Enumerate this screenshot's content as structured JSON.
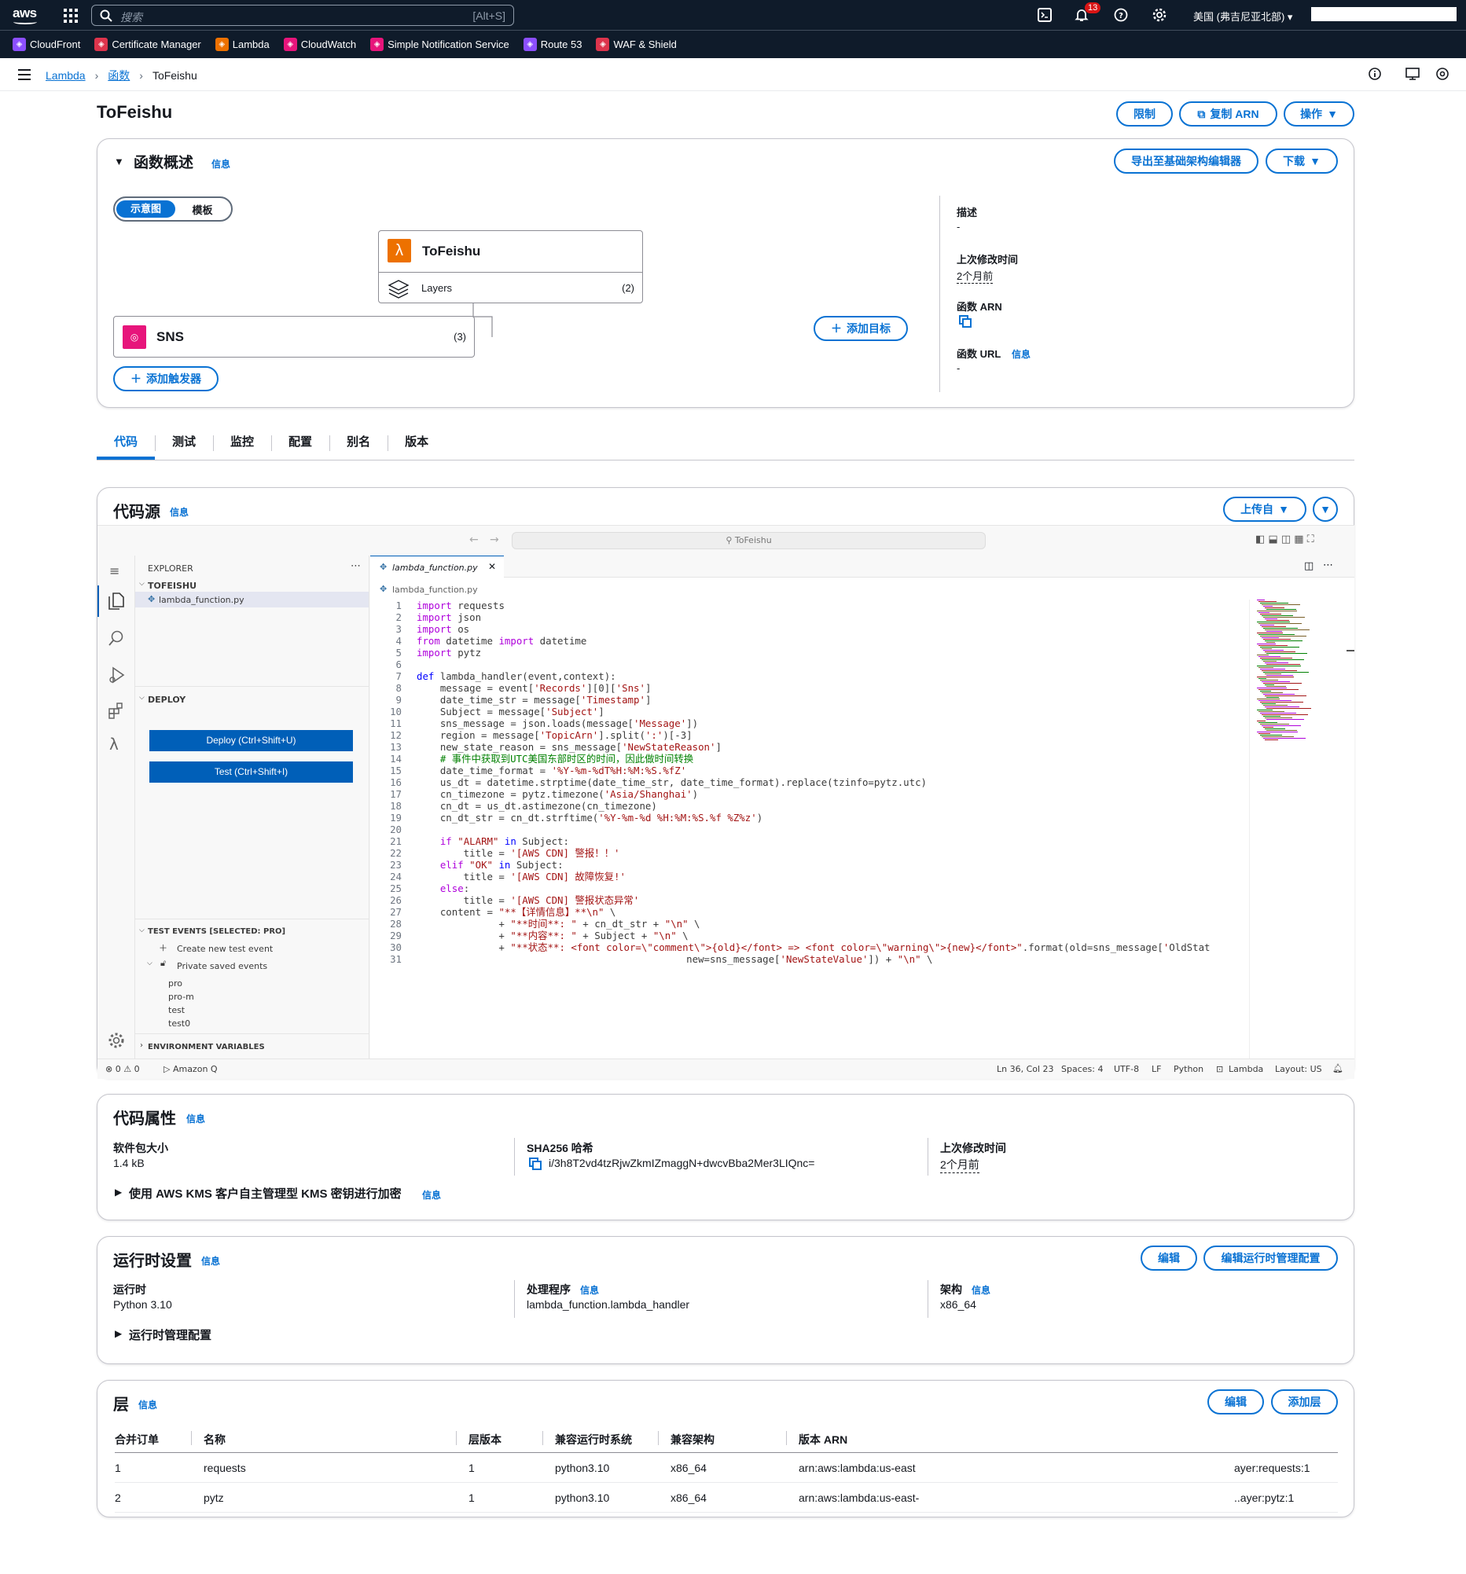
{
  "topnav": {
    "search_placeholder": "搜索",
    "search_shortcut": "[Alt+S]",
    "notif_count": "13",
    "region": "美国 (弗吉尼亚北部) ▾"
  },
  "favorites": [
    {
      "label": "CloudFront",
      "color": "#8c4fff"
    },
    {
      "label": "Certificate Manager",
      "color": "#dd344c"
    },
    {
      "label": "Lambda",
      "color": "#ed7100"
    },
    {
      "label": "CloudWatch",
      "color": "#e7157b"
    },
    {
      "label": "Simple Notification Service",
      "color": "#e7157b"
    },
    {
      "label": "Route 53",
      "color": "#8c4fff"
    },
    {
      "label": "WAF & Shield",
      "color": "#dd344c"
    }
  ],
  "breadcrumb": {
    "l1": "Lambda",
    "l2": "函数",
    "l3": "ToFeishu"
  },
  "page": {
    "title": "ToFeishu",
    "throttle": "限制",
    "copy_arn": "复制 ARN",
    "actions": "操作"
  },
  "overview": {
    "title": "函数概述",
    "info": "信息",
    "export": "导出至基础架构编辑器",
    "download": "下载",
    "seg_on": "示意图",
    "seg_off": "模板",
    "fn_name": "ToFeishu",
    "layers": "Layers",
    "layers_count": "(2)",
    "trigger": "SNS",
    "trigger_count": "(3)",
    "add_trigger": "添加触发器",
    "add_target": "添加目标",
    "desc_label": "描述",
    "desc_val": "-",
    "mod_label": "上次修改时间",
    "mod_val": "2个月前",
    "arn_label": "函数 ARN",
    "url_label": "函数 URL",
    "url_info": "信息",
    "url_val": "-"
  },
  "tabs": [
    "代码",
    "测试",
    "监控",
    "配置",
    "别名",
    "版本"
  ],
  "codesrc": {
    "title": "代码源",
    "info": "信息",
    "upload": "上传自",
    "crumb": "ToFeishu",
    "explorer": "EXPLORER",
    "folder": "TOFEISHU",
    "file": "lambda_function.py",
    "deploy_sec": "DEPLOY",
    "deploy_btn": "Deploy (Ctrl+Shift+U)",
    "test_btn": "Test (Ctrl+Shift+I)",
    "test_events": "TEST EVENTS [SELECTED: PRO]",
    "create_evt": "Create new test event",
    "private": "Private saved events",
    "events": [
      "pro",
      "pro-m",
      "test",
      "test0"
    ],
    "env": "ENVIRONMENT VARIABLES",
    "tab_file": "lambda_function.py",
    "path": "lambda_function.py",
    "status": {
      "problems": "⊗ 0 ⚠ 0",
      "amazonq": "▷ Amazon Q",
      "pos": "Ln 36, Col 23",
      "spaces": "Spaces: 4",
      "enc": "UTF-8",
      "eol": "LF",
      "lang": "Python",
      "lambda": "Lambda",
      "layout": "Layout: US"
    }
  },
  "code_lines": [
    "import requests",
    "import json",
    "import os",
    "from datetime import datetime",
    "import pytz",
    "",
    "def lambda_handler(event,context):",
    "    message = event['Records'][0]['Sns']",
    "    date_time_str = message['Timestamp']",
    "    Subject = message['Subject']",
    "    sns_message = json.loads(message['Message'])",
    "    region = message['TopicArn'].split(':')[-3]",
    "    new_state_reason = sns_message['NewStateReason']",
    "    # 事件中获取到UTC美国东部时区的时间，因此做时间转换",
    "    date_time_format = '%Y-%m-%dT%H:%M:%S.%fZ'",
    "    us_dt = datetime.strptime(date_time_str, date_time_format).replace(tzinfo=pytz.utc)",
    "    cn_timezone = pytz.timezone('Asia/Shanghai')",
    "    cn_dt = us_dt.astimezone(cn_timezone)",
    "    cn_dt_str = cn_dt.strftime('%Y-%m-%d %H:%M:%S.%f %Z%z')",
    "",
    "    if \"ALARM\" in Subject:",
    "        title = '[AWS CDN] 警报！！'",
    "    elif \"OK\" in Subject:",
    "        title = '[AWS CDN] 故障恢复!'",
    "    else:",
    "        title = '[AWS CDN] 警报状态异常'",
    "    content = \"**【详情信息】**\\n\" \\",
    "              + \"**时间**: \" + cn_dt_str + \"\\n\" \\",
    "              + \"**内容**: \" + Subject + \"\\n\" \\",
    "              + \"**状态**: <font color=\\\"comment\\\">{old}</font> => <font color=\\\"warning\\\">{new}</font>\".format(old=sns_message['OldStat",
    "                                              new=sns_message['NewStateValue']) + \"\\n\" \\"
  ],
  "codeprops": {
    "title": "代码属性",
    "info": "信息",
    "size_label": "软件包大小",
    "size_val": "1.4 kB",
    "sha_label": "SHA256 哈希",
    "sha_val": "i/3h8T2vd4tzRjwZkmIZmaggN+dwcvBba2Mer3LIQnc=",
    "mod_label": "上次修改时间",
    "mod_val": "2个月前",
    "kms": "使用 AWS KMS 客户自主管理型 KMS 密钥进行加密",
    "kms_info": "信息"
  },
  "runtime": {
    "title": "运行时设置",
    "info": "信息",
    "edit": "编辑",
    "edit_mgmt": "编辑运行时管理配置",
    "rt_label": "运行时",
    "rt_val": "Python 3.10",
    "handler_label": "处理程序",
    "handler_info": "信息",
    "handler_val": "lambda_function.lambda_handler",
    "arch_label": "架构",
    "arch_info": "信息",
    "arch_val": "x86_64",
    "mgmt": "运行时管理配置"
  },
  "layers": {
    "title": "层",
    "info": "信息",
    "edit": "编辑",
    "add": "添加层",
    "headers": [
      "合并订单",
      "名称",
      "层版本",
      "兼容运行时系统",
      "兼容架构",
      "版本 ARN"
    ],
    "rows": [
      [
        "1",
        "requests",
        "1",
        "python3.10",
        "x86_64",
        "arn:aws:lambda:us-east",
        "ayer:requests:1"
      ],
      [
        "2",
        "pytz",
        "1",
        "python3.10",
        "x86_64",
        "arn:aws:lambda:us-east-",
        "..ayer:pytz:1"
      ]
    ]
  }
}
